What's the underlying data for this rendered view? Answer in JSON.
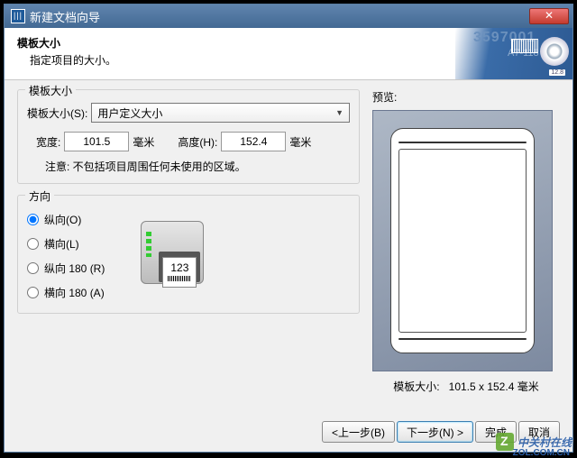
{
  "window": {
    "title": "新建文档向导"
  },
  "header": {
    "title": "模板大小",
    "subtitle": "指定项目的大小。"
  },
  "banner": {
    "num": "3597001",
    "a7": "A7-118",
    "tag": "12.8"
  },
  "size": {
    "legend": "模板大小",
    "s_label": "模板大小(S):",
    "s_value": "用户定义大小",
    "width_label": "宽度:",
    "width_value": "101.5",
    "width_unit": "毫米",
    "height_label": "高度(H):",
    "height_value": "152.4",
    "height_unit": "毫米",
    "note": "注意: 不包括项目周围任何未使用的区域。"
  },
  "orient": {
    "legend": "方向",
    "options": [
      {
        "label": "纵向(O)",
        "checked": true
      },
      {
        "label": "横向(L)",
        "checked": false
      },
      {
        "label": "纵向 180 (R)",
        "checked": false
      },
      {
        "label": "横向 180 (A)",
        "checked": false
      }
    ],
    "sample_num": "123"
  },
  "preview": {
    "label": "预览:",
    "caption_prefix": "模板大小:",
    "caption_value": "101.5 x 152.4 毫米"
  },
  "footer": {
    "back": "<上一步(B)",
    "next": "下一步(N) >",
    "finish": "完成",
    "cancel": "取消"
  },
  "watermark": {
    "text": "中关村在线",
    "url": "ZOL.COM.CN"
  }
}
